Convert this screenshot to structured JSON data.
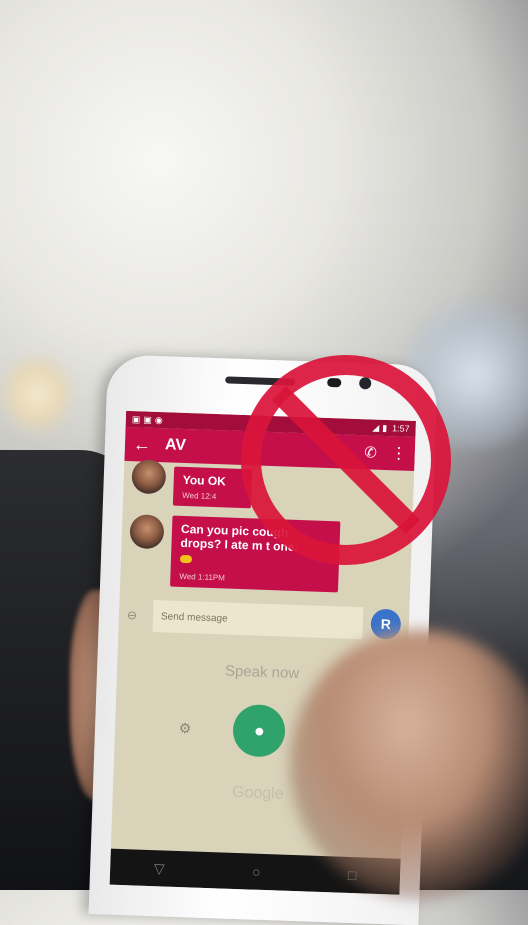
{
  "phone": {
    "status_clock": "1:57",
    "app_bar": {
      "contact": "AV"
    },
    "messages": [
      {
        "text": "You OK",
        "time": "Wed 12:4"
      },
      {
        "text": "Can you pic   cough drops? I ate m    t one.",
        "time": "Wed 1:11PM"
      }
    ],
    "compose": {
      "placeholder": "Send message",
      "avatar_letter": "R"
    },
    "voice": {
      "prompt": "Speak now",
      "brand": "Google"
    }
  },
  "colors": {
    "accent": "#c40f4b",
    "status_bar": "#a30d3c",
    "mic": "#2fa36b",
    "avatar_blue": "#3b73c8",
    "prohibition_red": "#d9143a"
  },
  "icons": [
    "back-arrow-icon",
    "phone-icon",
    "overflow-icon",
    "attach-icon",
    "settings-icon",
    "mic-icon",
    "back-nav-icon",
    "home-nav-icon",
    "recents-nav-icon",
    "prohibition-sign"
  ]
}
